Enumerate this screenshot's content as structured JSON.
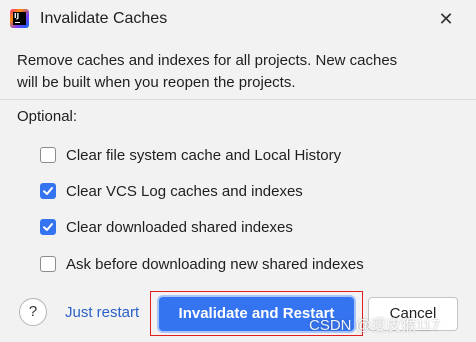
{
  "dialog": {
    "title": "Invalidate Caches",
    "app_icon_text": "IJ",
    "close_icon": "close-icon"
  },
  "description": {
    "line1": "Remove caches and indexes for all projects. New caches",
    "line2": "will be built when you reopen the projects."
  },
  "optional": {
    "label": "Optional:",
    "options": [
      {
        "label": "Clear file system cache and Local History",
        "checked": false
      },
      {
        "label": "Clear VCS Log caches and indexes",
        "checked": true
      },
      {
        "label": "Clear downloaded shared indexes",
        "checked": true
      },
      {
        "label": "Ask before downloading new shared indexes",
        "checked": false
      }
    ]
  },
  "footer": {
    "help": "?",
    "just_restart": "Just restart",
    "invalidate_restart": "Invalidate and Restart",
    "cancel": "Cancel"
  },
  "watermark": "CSDN @瘦皮猴117",
  "colors": {
    "accent": "#3574f0",
    "link": "#2b61c9",
    "highlight_border": "#e02020"
  }
}
